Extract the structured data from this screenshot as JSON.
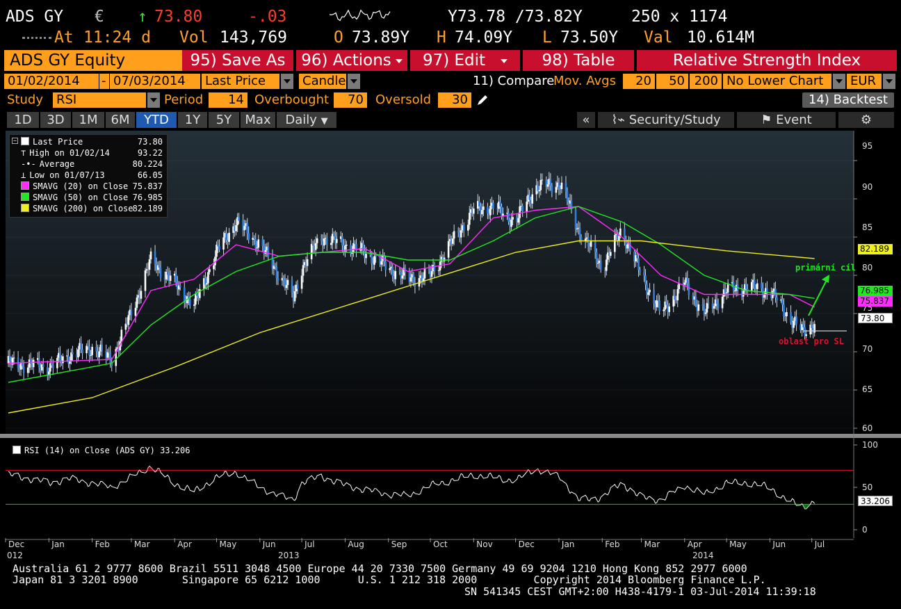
{
  "header": {
    "ticker": "ADS GY",
    "currency": "€",
    "arrow": "↑",
    "last": "73.80",
    "change": "-.03",
    "bid_ask": "Y73.78 /73.82Y",
    "bid_ask_size": "250 x 1174",
    "time_prefix": "At",
    "time": "11:24 d",
    "vol_label": "Vol",
    "vol": "143,769",
    "open_label": "O",
    "open": "73.89Y",
    "high_label": "H",
    "high": "74.09Y",
    "low_label": "L",
    "low": "73.50Y",
    "val_label": "Val",
    "val": "10.614M"
  },
  "function_bar": {
    "title": "ADS GY Equity",
    "save_as": "95) Save As",
    "actions": "96) Actions",
    "edit": "97) Edit",
    "table": "98) Table",
    "study_title": "Relative Strength Index"
  },
  "params": {
    "start_date": "01/02/2014",
    "dash": "-",
    "end_date": "07/03/2014",
    "price": "Last Price",
    "style": "Candle",
    "compare": "11) Compare",
    "mov_avgs": "Mov. Avgs",
    "ma1": "20",
    "ma2": "50",
    "ma3": "200",
    "lower_chart": "No Lower Chart",
    "currency": "EUR"
  },
  "study": {
    "label": "Study",
    "name": "RSI",
    "period_label": "Period",
    "period": "14",
    "overbought_label": "Overbought",
    "overbought": "70",
    "oversold_label": "Oversold",
    "oversold": "30",
    "backtest": "14) Backtest"
  },
  "tabs": {
    "t1d": "1D",
    "t3d": "3D",
    "t1m": "1M",
    "t6m": "6M",
    "tytd": "YTD",
    "t1y": "1Y",
    "t5y": "5Y",
    "tmax": "Max",
    "daily": "Daily",
    "collapse": "«",
    "security_study": "Security/Study",
    "event": "Event"
  },
  "legend": {
    "items": [
      {
        "label": "Last Price",
        "value": "73.80",
        "swatch": "#ffffff"
      },
      {
        "label": "High on 01/02/14",
        "value": "93.22"
      },
      {
        "label": "Average",
        "value": "80.224"
      },
      {
        "label": "Low on 01/07/13",
        "value": "66.05"
      },
      {
        "label": "SMAVG (20) on Close",
        "value": "75.837",
        "swatch": "#ff2bff"
      },
      {
        "label": "SMAVG (50) on Close",
        "value": "76.985",
        "swatch": "#22e622"
      },
      {
        "label": "SMAVG (200) on Close",
        "value": "82.189",
        "swatch": "#f0f020"
      }
    ],
    "rsi_label": "RSI (14) on Close (ADS GY) 33.206"
  },
  "price_tags": {
    "sma200": "82.189",
    "sma50": "76.985",
    "sma20": "75.837",
    "last": "73.80",
    "rsi": "33.206"
  },
  "annotations": {
    "target": "primární cíl",
    "stop": "oblast pro SL"
  },
  "y_axis": {
    "price_ticks": [
      "95",
      "90",
      "85",
      "80",
      "75",
      "70",
      "65",
      "60"
    ],
    "rsi_ticks": [
      "100",
      "50",
      "0"
    ]
  },
  "x_axis": {
    "months": [
      "Dec",
      "Jan",
      "Feb",
      "Mar",
      "Apr",
      "May",
      "Jun",
      "Jul",
      "Aug",
      "Sep",
      "Oct",
      "Nov",
      "Dec",
      "Jan",
      "Feb",
      "Mar",
      "Apr",
      "May",
      "Jun",
      "Jul"
    ],
    "years": {
      "start": "012",
      "mid": "2013",
      "end": "2014"
    }
  },
  "footer": {
    "line1": "Australia 61 2 9777 8600 Brazil 5511 3048 4500 Europe 44 20 7330 7500 Germany 49 69 9204 1210 Hong Kong 852 2977 6000",
    "line2": "Japan 81 3 3201 8900       Singapore 65 6212 1000      U.S. 1 212 318 2000         Copyright 2014 Bloomberg Finance L.P.",
    "line3": "SN 541345 CEST GMT+2:00 H438-4179-1 03-Jul-2014 11:39:18"
  },
  "chart_data": [
    {
      "type": "line",
      "title": "ADS GY",
      "x_range": [
        "2012-12-01",
        "2014-07-31"
      ],
      "ylim": [
        60,
        97
      ],
      "series": [
        {
          "name": "Last Price",
          "points": [
            [
              "2012-12-03",
              68.5
            ],
            [
              "2013-01-02",
              68
            ],
            [
              "2013-01-15",
              69.5
            ],
            [
              "2013-02-01",
              70.5
            ],
            [
              "2013-02-15",
              69
            ],
            [
              "2013-03-01",
              75
            ],
            [
              "2013-03-15",
              82
            ],
            [
              "2013-04-01",
              79
            ],
            [
              "2013-04-15",
              76
            ],
            [
              "2013-05-01",
              83
            ],
            [
              "2013-05-15",
              87
            ],
            [
              "2013-06-01",
              84
            ],
            [
              "2013-06-15",
              80
            ],
            [
              "2013-06-25",
              77
            ],
            [
              "2013-07-01",
              81
            ],
            [
              "2013-07-15",
              85
            ],
            [
              "2013-08-01",
              84
            ],
            [
              "2013-08-15",
              83
            ],
            [
              "2013-09-01",
              81
            ],
            [
              "2013-09-15",
              79.5
            ],
            [
              "2013-10-01",
              80
            ],
            [
              "2013-10-15",
              84
            ],
            [
              "2013-11-01",
              88.5
            ],
            [
              "2013-11-15",
              89
            ],
            [
              "2013-12-01",
              87
            ],
            [
              "2013-12-15",
              91.5
            ],
            [
              "2014-01-02",
              92
            ],
            [
              "2014-01-15",
              86
            ],
            [
              "2014-02-01",
              81
            ],
            [
              "2014-02-15",
              86
            ],
            [
              "2014-03-01",
              80
            ],
            [
              "2014-03-15",
              75
            ],
            [
              "2014-04-01",
              79
            ],
            [
              "2014-04-15",
              75
            ],
            [
              "2014-05-01",
              78
            ],
            [
              "2014-05-15",
              78.5
            ],
            [
              "2014-06-01",
              78
            ],
            [
              "2014-06-15",
              74.5
            ],
            [
              "2014-06-25",
              72.5
            ],
            [
              "2014-07-03",
              73.8
            ]
          ]
        },
        {
          "name": "SMAVG (20) on Close",
          "points": [
            [
              "2012-12-03",
              68.5
            ],
            [
              "2013-02-15",
              69
            ],
            [
              "2013-03-15",
              78
            ],
            [
              "2013-04-15",
              79.5
            ],
            [
              "2013-05-15",
              84
            ],
            [
              "2013-06-15",
              82.5
            ],
            [
              "2013-07-15",
              83
            ],
            [
              "2013-08-15",
              83.5
            ],
            [
              "2013-09-15",
              80.5
            ],
            [
              "2013-10-15",
              81.5
            ],
            [
              "2013-11-15",
              87.5
            ],
            [
              "2013-12-15",
              88.5
            ],
            [
              "2014-01-15",
              89
            ],
            [
              "2014-02-15",
              85
            ],
            [
              "2014-03-15",
              80
            ],
            [
              "2014-04-15",
              77.5
            ],
            [
              "2014-05-15",
              77.5
            ],
            [
              "2014-06-15",
              77.5
            ],
            [
              "2014-07-03",
              75.837
            ]
          ]
        },
        {
          "name": "SMAVG (50) on Close",
          "points": [
            [
              "2012-12-03",
              66
            ],
            [
              "2013-02-15",
              68.5
            ],
            [
              "2013-03-15",
              73.5
            ],
            [
              "2013-04-15",
              77.5
            ],
            [
              "2013-05-15",
              80.5
            ],
            [
              "2013-06-15",
              82.5
            ],
            [
              "2013-07-15",
              83
            ],
            [
              "2013-08-15",
              83
            ],
            [
              "2013-09-15",
              82
            ],
            [
              "2013-10-15",
              82
            ],
            [
              "2013-11-15",
              84.5
            ],
            [
              "2013-12-15",
              87.5
            ],
            [
              "2014-01-15",
              89
            ],
            [
              "2014-02-15",
              87
            ],
            [
              "2014-03-15",
              84
            ],
            [
              "2014-04-15",
              80
            ],
            [
              "2014-05-15",
              78
            ],
            [
              "2014-06-15",
              77.5
            ],
            [
              "2014-07-03",
              76.985
            ]
          ]
        },
        {
          "name": "SMAVG (200) on Close",
          "points": [
            [
              "2012-12-03",
              62
            ],
            [
              "2013-02-01",
              64
            ],
            [
              "2013-04-01",
              68
            ],
            [
              "2013-06-01",
              72.5
            ],
            [
              "2013-08-01",
              76
            ],
            [
              "2013-10-01",
              79.5
            ],
            [
              "2013-12-01",
              83
            ],
            [
              "2014-01-15",
              84.5
            ],
            [
              "2014-03-01",
              84.5
            ],
            [
              "2014-05-01",
              83.2
            ],
            [
              "2014-07-03",
              82.189
            ]
          ]
        }
      ]
    },
    {
      "type": "line",
      "title": "RSI (14) on Close (ADS GY)",
      "x_range": [
        "2012-12-01",
        "2014-07-31"
      ],
      "ylim": [
        0,
        100
      ],
      "thresholds": {
        "overbought": 70,
        "oversold": 30
      },
      "series": [
        {
          "name": "RSI (14)",
          "points": [
            [
              "2012-12-03",
              65
            ],
            [
              "2013-01-02",
              55
            ],
            [
              "2013-01-15",
              60
            ],
            [
              "2013-02-01",
              55
            ],
            [
              "2013-02-15",
              50
            ],
            [
              "2013-03-01",
              62
            ],
            [
              "2013-03-15",
              75
            ],
            [
              "2013-04-01",
              55
            ],
            [
              "2013-04-15",
              45
            ],
            [
              "2013-05-01",
              62
            ],
            [
              "2013-05-15",
              68
            ],
            [
              "2013-06-01",
              50
            ],
            [
              "2013-06-15",
              40
            ],
            [
              "2013-06-25",
              35
            ],
            [
              "2013-07-01",
              55
            ],
            [
              "2013-07-15",
              63
            ],
            [
              "2013-08-01",
              52
            ],
            [
              "2013-08-15",
              47
            ],
            [
              "2013-09-01",
              42
            ],
            [
              "2013-09-15",
              40
            ],
            [
              "2013-10-01",
              52
            ],
            [
              "2013-10-15",
              58
            ],
            [
              "2013-11-01",
              65
            ],
            [
              "2013-11-15",
              62
            ],
            [
              "2013-12-01",
              58
            ],
            [
              "2013-12-15",
              72
            ],
            [
              "2014-01-02",
              62
            ],
            [
              "2014-01-15",
              35
            ],
            [
              "2014-02-01",
              38
            ],
            [
              "2014-02-15",
              55
            ],
            [
              "2014-03-01",
              38
            ],
            [
              "2014-03-15",
              35
            ],
            [
              "2014-04-01",
              52
            ],
            [
              "2014-04-15",
              42
            ],
            [
              "2014-05-01",
              55
            ],
            [
              "2014-05-15",
              56
            ],
            [
              "2014-06-01",
              50
            ],
            [
              "2014-06-15",
              33
            ],
            [
              "2014-06-25",
              28
            ],
            [
              "2014-07-03",
              33.206
            ]
          ]
        }
      ]
    }
  ]
}
